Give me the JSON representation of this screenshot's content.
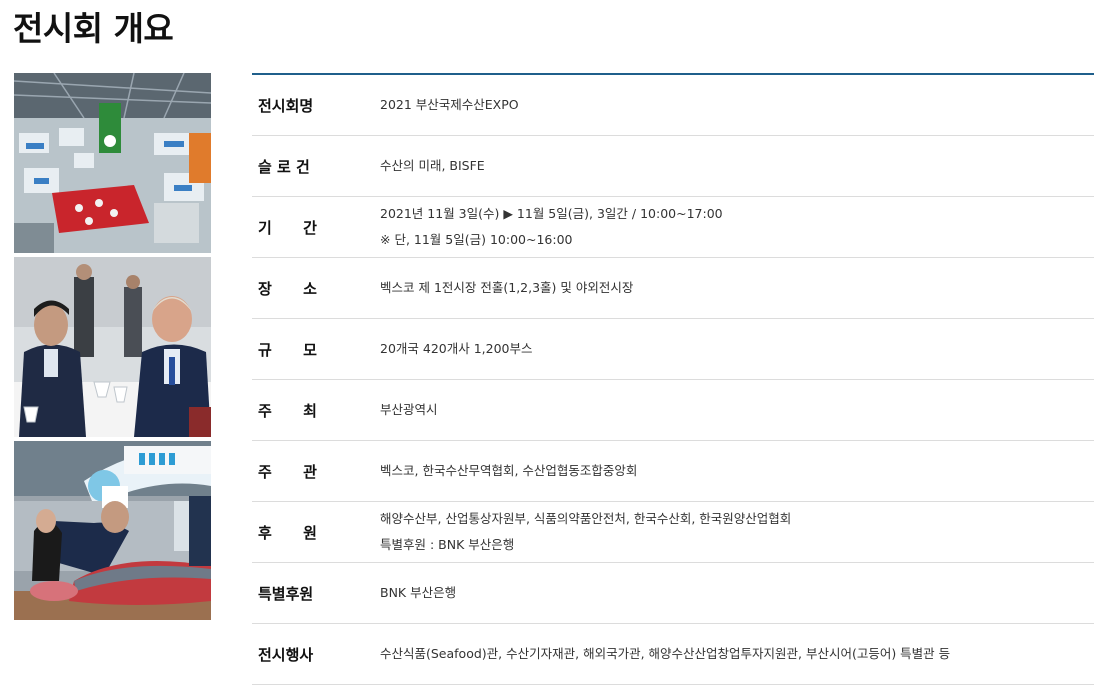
{
  "page": {
    "title": "전시회 개요"
  },
  "photos": [
    {
      "name": "exhibition-hall-photo"
    },
    {
      "name": "business-meeting-photo"
    },
    {
      "name": "tuna-cutting-photo"
    }
  ],
  "overview": {
    "rows": [
      {
        "label": "전시회명",
        "values": [
          "2021 부산국제수산EXPO"
        ]
      },
      {
        "label": "슬 로 건",
        "values": [
          "수산의 미래, BISFE"
        ]
      },
      {
        "label": "기      간",
        "values": [
          "2021년 11월 3일(수) ▶ 11월 5일(금), 3일간 / 10:00~17:00",
          "※ 단, 11월 5일(금) 10:00~16:00"
        ]
      },
      {
        "label": "장      소",
        "values": [
          "벡스코 제 1전시장 전홀(1,2,3홀) 및 야외전시장"
        ]
      },
      {
        "label": "규      모",
        "values": [
          "20개국 420개사 1,200부스"
        ]
      },
      {
        "label": "주      최",
        "values": [
          "부산광역시"
        ]
      },
      {
        "label": "주      관",
        "values": [
          "벡스코, 한국수산무역협회, 수산업협동조합중앙회"
        ]
      },
      {
        "label": "후      원",
        "values": [
          "해양수산부, 산업통상자원부, 식품의약품안전처, 한국수산회, 한국원양산업협회",
          "특별후원 : BNK 부산은행"
        ]
      },
      {
        "label": "특별후원",
        "values": [
          "BNK 부산은행"
        ]
      },
      {
        "label": "전시행사",
        "values": [
          "수산식품(Seafood)관, 수산기자재관, 해외국가관, 해양수산산업창업투자지원관, 부산시어(고등어) 특별관 등"
        ]
      }
    ]
  }
}
